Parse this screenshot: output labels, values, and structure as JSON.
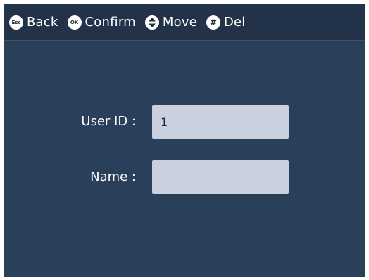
{
  "topbar": {
    "hints": [
      {
        "key": "Esc",
        "label": "Back",
        "icon": "esc-key-icon"
      },
      {
        "key": "OK",
        "label": "Confirm",
        "icon": "ok-key-icon"
      },
      {
        "key": "updown",
        "label": "Move",
        "icon": "up-down-arrows-icon"
      },
      {
        "key": "#",
        "label": "Del",
        "icon": "hash-key-icon"
      }
    ]
  },
  "form": {
    "user_id": {
      "label": "User ID :",
      "value": "1"
    },
    "name": {
      "label": "Name :",
      "value": ""
    }
  },
  "colors": {
    "screen_bg": "#2a3f5a",
    "topbar_bg": "#223349",
    "input_bg": "#c9d1de",
    "text": "#ffffff"
  }
}
